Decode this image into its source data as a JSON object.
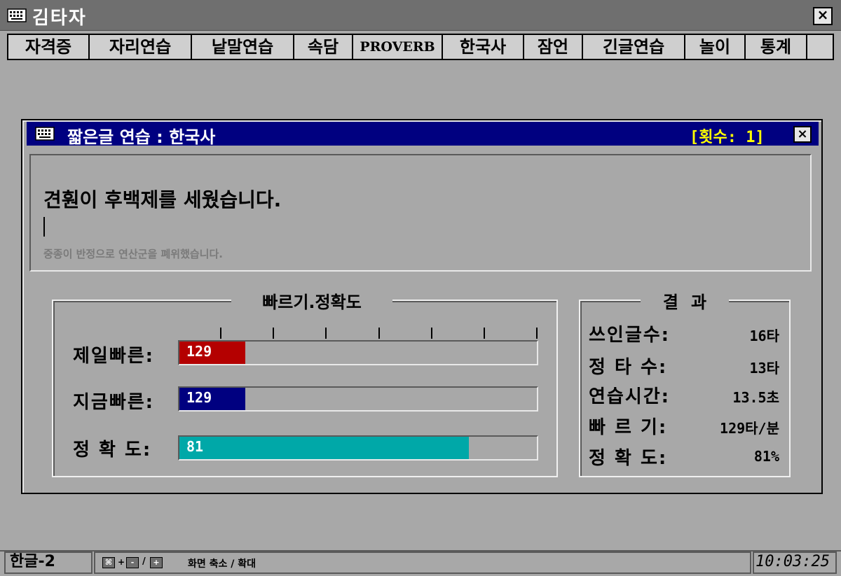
{
  "window": {
    "title": "김타자",
    "close_icon": "×"
  },
  "menu": {
    "items": [
      {
        "label": "자격증"
      },
      {
        "label": "자리연습"
      },
      {
        "label": "낱말연습"
      },
      {
        "label": "속담"
      },
      {
        "label": "PROVERB"
      },
      {
        "label": "한국사"
      },
      {
        "label": "잠언"
      },
      {
        "label": "긴글연습"
      },
      {
        "label": "놀이"
      },
      {
        "label": "통계"
      }
    ]
  },
  "dialog": {
    "title": "짧은글 연습 : 한국사",
    "count": "[횟수: 1]",
    "close_icon": "×",
    "current_sentence": "견훤이 후백제를 세웠습니다.",
    "next_sentence": "중종이 반정으로 연산군을 폐위했습니다."
  },
  "speed": {
    "legend": "빠르기.정확도",
    "rows": [
      {
        "label": "제일빠른:",
        "value": "129",
        "fill_fraction": 0.184,
        "color": "#b40000"
      },
      {
        "label": "지금빠른:",
        "value": "129",
        "fill_fraction": 0.184,
        "color": "#000080"
      },
      {
        "label": "정 확 도:",
        "value": "81",
        "fill_fraction": 0.81,
        "color": "#00a8a8"
      }
    ]
  },
  "result": {
    "legend": "결과",
    "items": [
      {
        "label": "쓰인글수:",
        "value": "16타"
      },
      {
        "label": "정 타 수:",
        "value": "13타"
      },
      {
        "label": "연습시간:",
        "value": "13.5초"
      },
      {
        "label": "빠 르 기:",
        "value": "129타/분"
      },
      {
        "label": "정 확 도:",
        "value": "81%"
      }
    ]
  },
  "status": {
    "ime": "한글-2",
    "zoom_keys": [
      "⌘",
      "-",
      "+"
    ],
    "zoom_text": "화면 축소 / 확대",
    "clock": "10:03:25"
  },
  "colors": {
    "dialog_title_bg": "#000080",
    "count_color": "#ffff00"
  }
}
